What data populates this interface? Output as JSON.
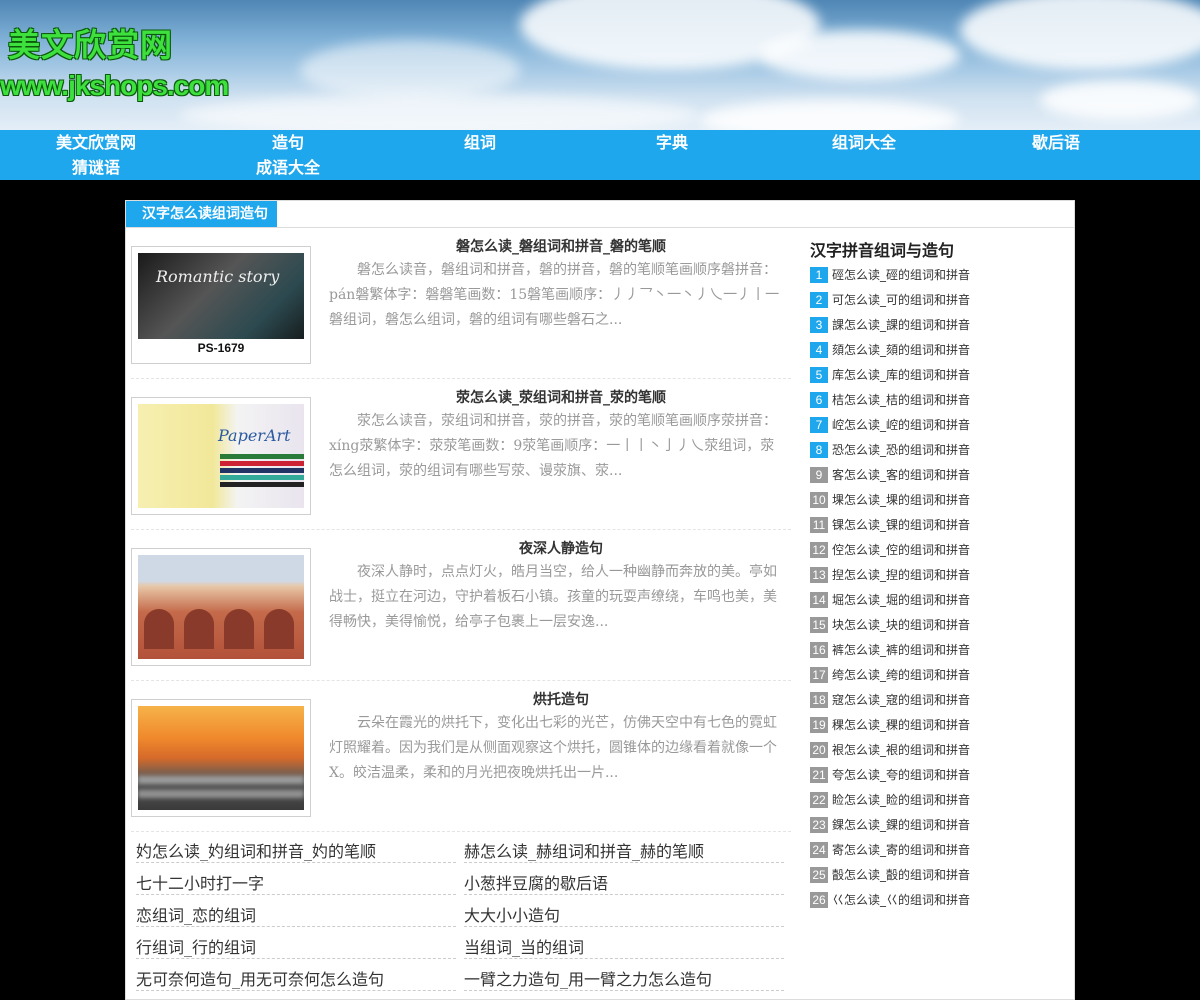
{
  "header": {
    "site_title": "美文欣赏网",
    "site_url": "www.jkshops.com"
  },
  "nav": {
    "items": [
      "美文欣赏网",
      "造句",
      "组词",
      "字典",
      "组词大全",
      "歇后语",
      "猜谜语",
      "成语大全"
    ]
  },
  "breadcrumb": {
    "label": "汉字怎么读组词造句"
  },
  "articles": [
    {
      "title": "磐怎么读_磐组词和拼音_磐的笔顺",
      "desc": "磐怎么读音，磐组词和拼音，磐的拼音，磐的笔顺笔画顺序磐拼音：pán磐繁体字：磐磐笔画数：15磐笔画顺序：丿丿乛丶一丶丿乀一丿丨一磐组词，磐怎么组词，磐的组词有哪些磐石之...",
      "thumb_caption": "PS-1679",
      "thumb_tag": "Romantic story"
    },
    {
      "title": "荥怎么读_荥组词和拼音_荥的笔顺",
      "desc": "荥怎么读音，荥组词和拼音，荥的拼音，荥的笔顺笔画顺序荥拼音：xíng荥繁体字：荥荥笔画数：9荥笔画顺序：一丨丨丶亅丿乀荥组词，荥怎么组词，荥的组词有哪些写荥、谩荥旗、荥...",
      "thumb_tag": "PaperArt"
    },
    {
      "title": "夜深人静造句",
      "desc": "夜深人静时，点点灯火，皓月当空，给人一种幽静而奔放的美。亭如战士，挺立在河边，守护着板石小镇。孩童的玩耍声缭绕，车鸣也美，美得畅快，美得愉悦，给亭子包裹上一层安逸..."
    },
    {
      "title": "烘托造句",
      "desc": "云朵在霞光的烘托下，变化出七彩的光芒，仿佛天空中有七色的霓虹灯照耀着。因为我们是从侧面观察这个烘托，圆锥体的边缘看着就像一个X。皎洁温柔，柔和的月光把夜晚烘托出一片..."
    }
  ],
  "links": [
    [
      "妁怎么读_妁组词和拼音_妁的笔顺",
      "赫怎么读_赫组词和拼音_赫的笔顺"
    ],
    [
      "七十二小时打一字",
      "小葱拌豆腐的歇后语"
    ],
    [
      "恋组词_恋的组词",
      "大大小小造句"
    ],
    [
      "行组词_行的组词",
      "当组词_当的组词"
    ],
    [
      "无可奈何造句_用无可奈何怎么造句",
      "一臂之力造句_用一臂之力怎么造句"
    ]
  ],
  "sidebar": {
    "title": "汉字拼音组词与造句",
    "items": [
      {
        "num": "1",
        "text": "硜怎么读_硜的组词和拼音"
      },
      {
        "num": "2",
        "text": "可怎么读_可的组词和拼音"
      },
      {
        "num": "3",
        "text": "課怎么读_課的组词和拼音"
      },
      {
        "num": "4",
        "text": "頦怎么读_頦的组词和拼音"
      },
      {
        "num": "5",
        "text": "库怎么读_库的组词和拼音"
      },
      {
        "num": "6",
        "text": "桔怎么读_桔的组词和拼音"
      },
      {
        "num": "7",
        "text": "崆怎么读_崆的组词和拼音"
      },
      {
        "num": "8",
        "text": "恐怎么读_恐的组词和拼音"
      },
      {
        "num": "9",
        "text": "客怎么读_客的组词和拼音"
      },
      {
        "num": "10",
        "text": "堁怎么读_堁的组词和拼音"
      },
      {
        "num": "11",
        "text": "锞怎么读_锞的组词和拼音"
      },
      {
        "num": "12",
        "text": "倥怎么读_倥的组词和拼音"
      },
      {
        "num": "13",
        "text": "揑怎么读_揑的组词和拼音"
      },
      {
        "num": "14",
        "text": "堀怎么读_堀的组词和拼音"
      },
      {
        "num": "15",
        "text": "块怎么读_块的组词和拼音"
      },
      {
        "num": "16",
        "text": "裤怎么读_裤的组词和拼音"
      },
      {
        "num": "17",
        "text": "绔怎么读_绔的组词和拼音"
      },
      {
        "num": "18",
        "text": "窛怎么读_窛的组词和拼音"
      },
      {
        "num": "19",
        "text": "稞怎么读_稞的组词和拼音"
      },
      {
        "num": "20",
        "text": "裉怎么读_裉的组词和拼音"
      },
      {
        "num": "21",
        "text": "夸怎么读_夸的组词和拼音"
      },
      {
        "num": "22",
        "text": "睑怎么读_睑的组词和拼音"
      },
      {
        "num": "23",
        "text": "錁怎么读_錁的组词和拼音"
      },
      {
        "num": "24",
        "text": "寄怎么读_寄的组词和拼音"
      },
      {
        "num": "25",
        "text": "瞉怎么读_瞉的组词和拼音"
      },
      {
        "num": "26",
        "text": "巜怎么读_巜的组词和拼音"
      }
    ]
  },
  "colors": {
    "nav_bg": "#1ea7ec",
    "accent": "#1ea7ec",
    "logo_green": "#3ee03e",
    "number_gray": "#999999"
  }
}
